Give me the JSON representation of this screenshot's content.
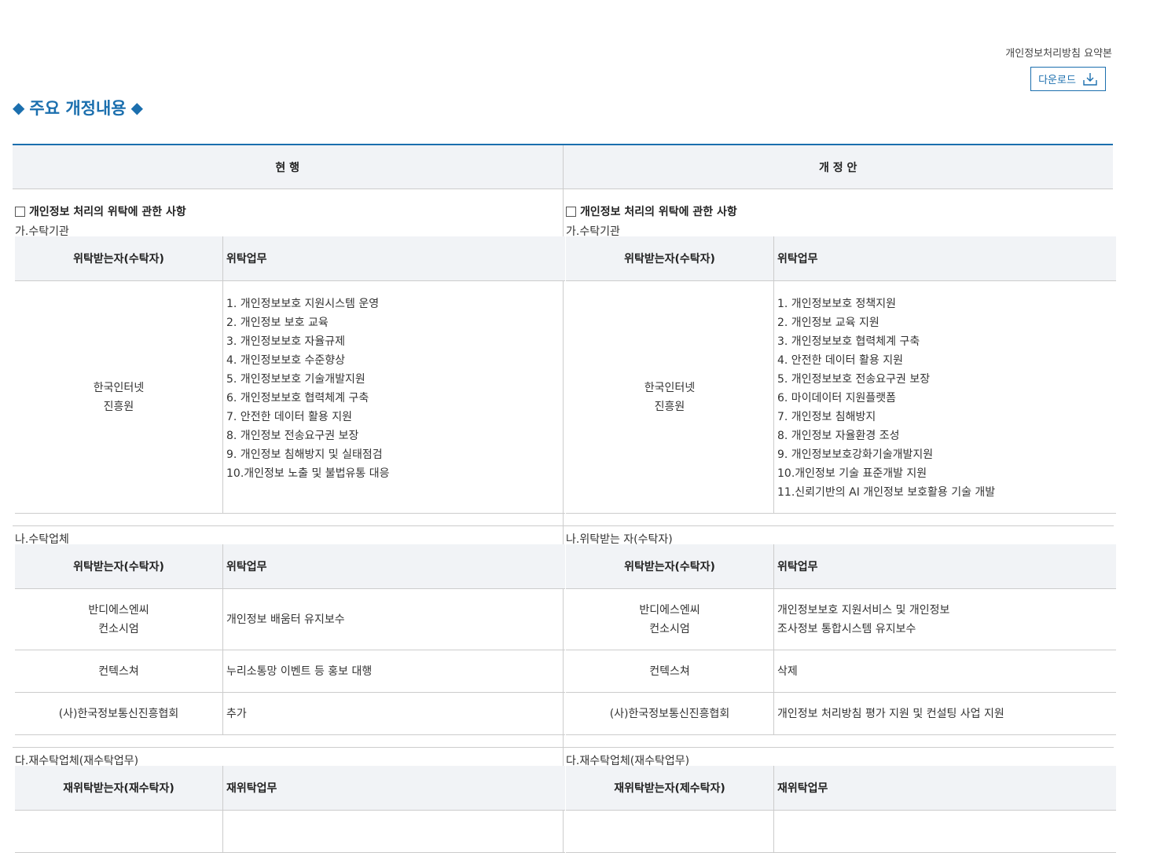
{
  "header": {
    "summary_label": "개인정보처리방침 요약본",
    "download_label": "다운로드"
  },
  "title": {
    "diamond": "◆",
    "text": "주요 개정내용"
  },
  "columns": {
    "current": "현 행",
    "proposed": "개 정 안"
  },
  "left": {
    "section_title": "개인정보 처리의 위탁에 관한 사항",
    "a": {
      "label": "가.수탁기관",
      "col1": "위탁받는자(수탁자)",
      "col2": "위탁업무",
      "org_line1": "한국인터넷",
      "org_line2": "진흥원",
      "items": [
        "1. 개인정보보호 지원시스템 운영",
        "2. 개인정보 보호 교육",
        "3. 개인정보보호 자율규제",
        "4. 개인정보보호 수준향상",
        "5. 개인정보보호 기술개발지원",
        "6. 개인정보보호 협력체계 구축",
        "7. 안전한 데이터 활용 지원",
        "8. 개인정보 전송요구권 보장",
        "9. 개인정보 침해방지 및 실태점검",
        "10.개인정보 노출 및 불법유통 대응"
      ]
    },
    "b": {
      "label": "나.수탁업체",
      "col1": "위탁받는자(수탁자)",
      "col2": "위탁업무",
      "rows": [
        {
          "org1": "반디에스엔씨",
          "org2": "컨소시엄",
          "task1": "개인정보 배움터 유지보수",
          "task2": ""
        },
        {
          "org1": "컨텍스쳐",
          "org2": "",
          "task1": "누리소통망 이벤트 등 홍보 대행",
          "task2": ""
        },
        {
          "org1": "(사)한국정보통신진흥협회",
          "org2": "",
          "task1": "추가",
          "task2": ""
        }
      ]
    },
    "c": {
      "label": "다.재수탁업체(재수탁업무)",
      "col1": "재위탁받는자(재수탁자)",
      "col2": "재위탁업무"
    }
  },
  "right": {
    "section_title": "개인정보 처리의 위탁에 관한 사항",
    "a": {
      "label": "가.수탁기관",
      "col1": "위탁받는자(수탁자)",
      "col2": "위탁업무",
      "org_line1": "한국인터넷",
      "org_line2": "진흥원",
      "items": [
        "1. 개인정보보호 정책지원",
        "2. 개인정보 교육 지원",
        "3. 개인정보보호 협력체계 구축",
        "4. 안전한 데이터 활용 지원",
        "5. 개인정보보호 전송요구권 보장",
        "6. 마이데이터 지원플랫폼",
        "7. 개인정보 침해방지",
        "8. 개인정보 자율환경 조성",
        "9. 개인정보보호강화기술개발지원",
        "10.개인정보 기술 표준개발 지원",
        "11.신뢰기반의 AI 개인정보 보호활용 기술 개발"
      ]
    },
    "b": {
      "label": "나.위탁받는 자(수탁자)",
      "col1": "위탁받는자(수탁자)",
      "col2": "위탁업무",
      "rows": [
        {
          "org1": "반디에스엔씨",
          "org2": "컨소시엄",
          "task1": "개인정보보호 지원서비스 및 개인정보",
          "task2": "조사정보 통합시스템 유지보수"
        },
        {
          "org1": "컨텍스쳐",
          "org2": "",
          "task1": "삭제",
          "task2": ""
        },
        {
          "org1": "(사)한국정보통신진흥협회",
          "org2": "",
          "task1": "개인정보 처리방침 평가 지원 및 컨설팅 사업 지원",
          "task2": ""
        }
      ]
    },
    "c": {
      "label": "다.재수탁업체(재수탁업무)",
      "col1": "재위탁받는자(제수탁자)",
      "col2": "재위탁업무"
    }
  },
  "colors": {
    "accent": "#1b6fae",
    "header_bg": "#f1f3f6",
    "border": "#cccccc"
  }
}
